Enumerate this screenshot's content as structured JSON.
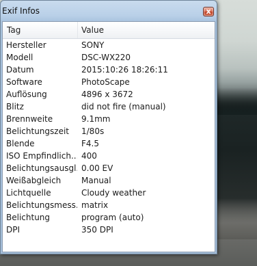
{
  "window": {
    "title": "Exif Infos",
    "close_glyph": "x"
  },
  "columns": {
    "tag": "Tag",
    "value": "Value"
  },
  "rows": [
    {
      "tag": "Hersteller",
      "value": "SONY"
    },
    {
      "tag": "Modell",
      "value": "DSC-WX220"
    },
    {
      "tag": "Datum",
      "value": "2015:10:26 18:26:11"
    },
    {
      "tag": "Software",
      "value": "PhotoScape"
    },
    {
      "tag": "Auflösung",
      "value": "4896 x 3672"
    },
    {
      "tag": "Blitz",
      "value": "did not fire (manual)"
    },
    {
      "tag": "Brennweite",
      "value": "9.1mm"
    },
    {
      "tag": "Belichtungszeit",
      "value": "1/80s"
    },
    {
      "tag": "Blende",
      "value": "F4.5"
    },
    {
      "tag": "ISO Empfindlich...",
      "value": "400"
    },
    {
      "tag": "Belichtungsausgl...",
      "value": "0.00 EV"
    },
    {
      "tag": "Weißabgleich",
      "value": "Manual"
    },
    {
      "tag": "Lichtquelle",
      "value": "Cloudy weather"
    },
    {
      "tag": "Belichtungsmess...",
      "value": "matrix"
    },
    {
      "tag": "Belichtung",
      "value": "program (auto)"
    },
    {
      "tag": "DPI",
      "value": "350 DPI"
    }
  ],
  "icons": {
    "close": "close-icon"
  }
}
